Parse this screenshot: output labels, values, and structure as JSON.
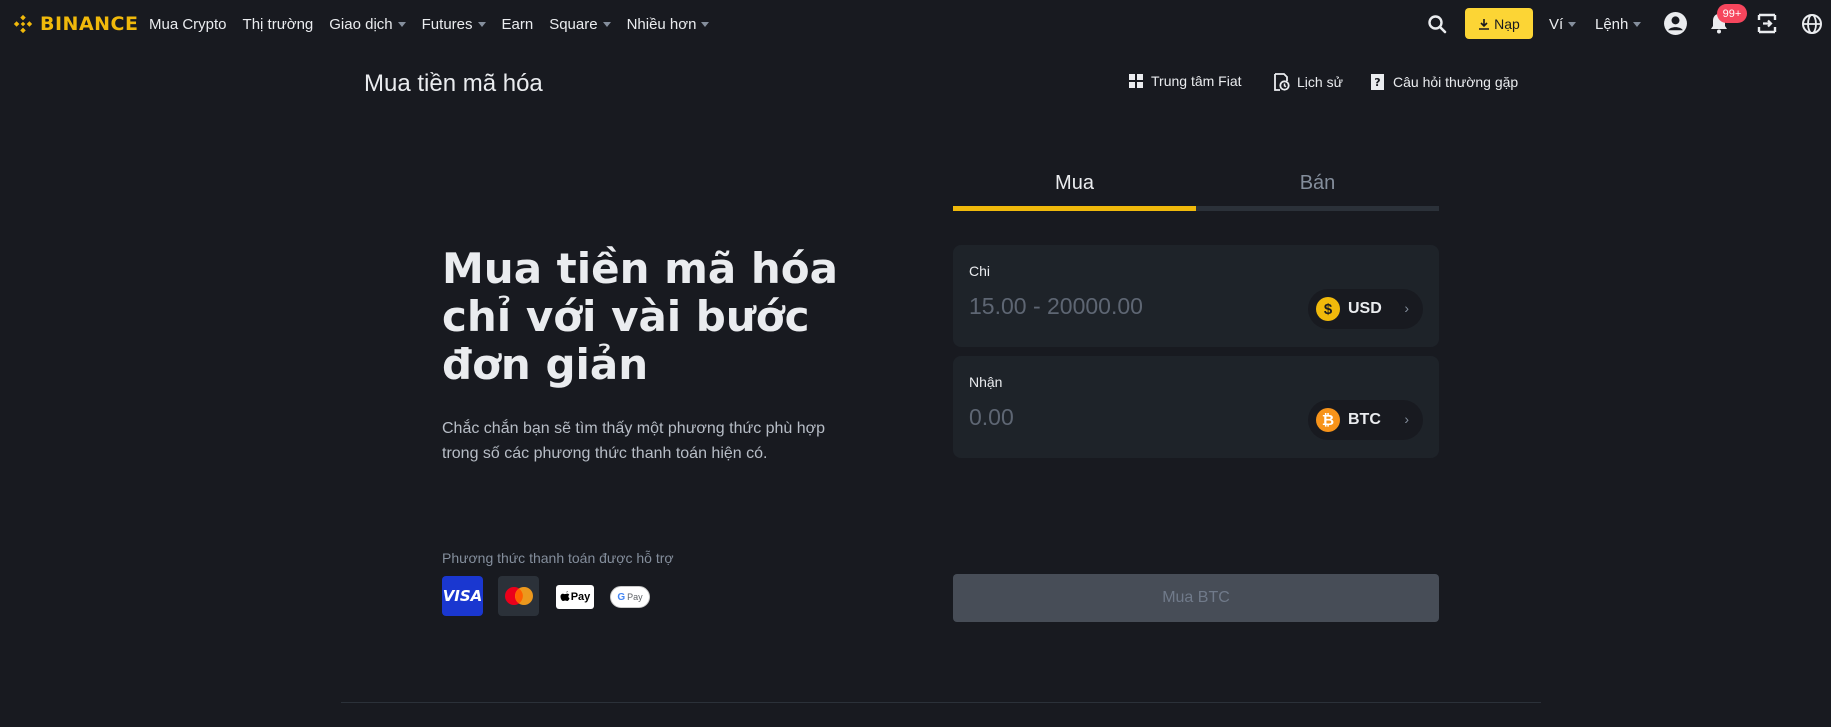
{
  "nav": {
    "brand": "BINANCE",
    "items": [
      {
        "label": "Mua Crypto",
        "dropdown": false
      },
      {
        "label": "Thị trường",
        "dropdown": false
      },
      {
        "label": "Giao dịch",
        "dropdown": true
      },
      {
        "label": "Futures",
        "dropdown": true
      },
      {
        "label": "Earn",
        "dropdown": false
      },
      {
        "label": "Square",
        "dropdown": true
      },
      {
        "label": "Nhiều hơn",
        "dropdown": true
      }
    ],
    "deposit_label": "Nạp",
    "wallet_label": "Ví",
    "orders_label": "Lệnh",
    "notification_count": "99+",
    "icons": [
      "search-icon",
      "download-icon",
      "user-icon",
      "bell-icon",
      "qr-download-icon",
      "globe-icon"
    ]
  },
  "header": {
    "title": "Mua tiền mã hóa",
    "links": [
      {
        "label": "Trung tâm Fiat",
        "icon": "grid-icon"
      },
      {
        "label": "Lịch sử",
        "icon": "history-icon"
      },
      {
        "label": "Câu hỏi thường gặp",
        "icon": "faq-icon"
      }
    ]
  },
  "hero": {
    "title": "Mua tiền mã hóa chỉ với vài bước đơn giản",
    "subtitle": "Chắc chắn bạn sẽ tìm thấy một phương thức phù hợp trong số các phương thức thanh toán hiện có.",
    "payment_methods_label": "Phương thức thanh toán được hỗ trợ",
    "payment_methods": [
      "VISA",
      "Mastercard",
      "Apple Pay",
      "Google Pay"
    ],
    "visa_text": "VISA",
    "applepay_text": "Pay",
    "gpay_text": "Pay"
  },
  "form": {
    "tabs": [
      {
        "label": "Mua",
        "active": true
      },
      {
        "label": "Bán",
        "active": false
      }
    ],
    "spend": {
      "label": "Chi",
      "placeholder": "15.00 - 20000.00",
      "currency": "USD",
      "currency_symbol": "$"
    },
    "receive": {
      "label": "Nhận",
      "placeholder": "0.00",
      "currency": "BTC",
      "currency_symbol": "₿"
    },
    "submit_label": "Mua BTC"
  },
  "colors": {
    "background": "#181a20",
    "accent": "#f0b90b",
    "button_yellow": "#fcd535",
    "panel": "#1e2329",
    "disabled_button": "#474d57"
  }
}
